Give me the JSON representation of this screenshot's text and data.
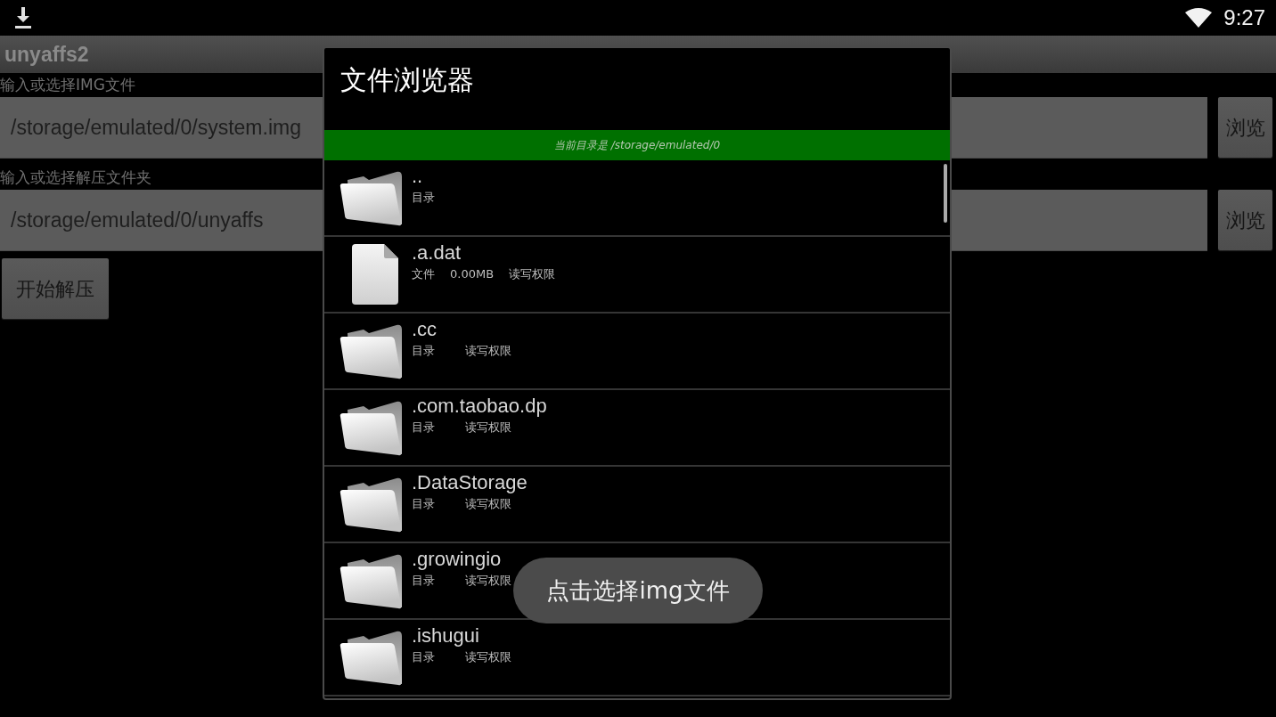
{
  "status_bar": {
    "time": "9:27"
  },
  "app": {
    "title": "unyaffs2",
    "fields": [
      {
        "label": "输入或选择IMG文件",
        "value": "/storage/emulated/0/system.img",
        "button": "浏览"
      },
      {
        "label": "输入或选择解压文件夹",
        "value": "/storage/emulated/0/unyaffs",
        "button": "浏览"
      }
    ],
    "start_button": "开始解压"
  },
  "dialog": {
    "title": "文件浏览器",
    "current_dir": "当前目录是 /storage/emulated/0",
    "entries": [
      {
        "kind": "folder",
        "name": "..",
        "type": "目录"
      },
      {
        "kind": "file",
        "name": ".a.dat",
        "type": "文件",
        "size": "0.00MB",
        "permission": "读写权限"
      },
      {
        "kind": "folder",
        "name": ".cc",
        "type": "目录",
        "permission": "读写权限"
      },
      {
        "kind": "folder",
        "name": ".com.taobao.dp",
        "type": "目录",
        "permission": "读写权限"
      },
      {
        "kind": "folder",
        "name": ".DataStorage",
        "type": "目录",
        "permission": "读写权限"
      },
      {
        "kind": "folder",
        "name": ".growingio",
        "type": "目录",
        "permission": "读写权限"
      },
      {
        "kind": "folder",
        "name": ".ishugui",
        "type": "目录",
        "permission": "读写权限"
      }
    ]
  },
  "toast": "点击选择img文件"
}
